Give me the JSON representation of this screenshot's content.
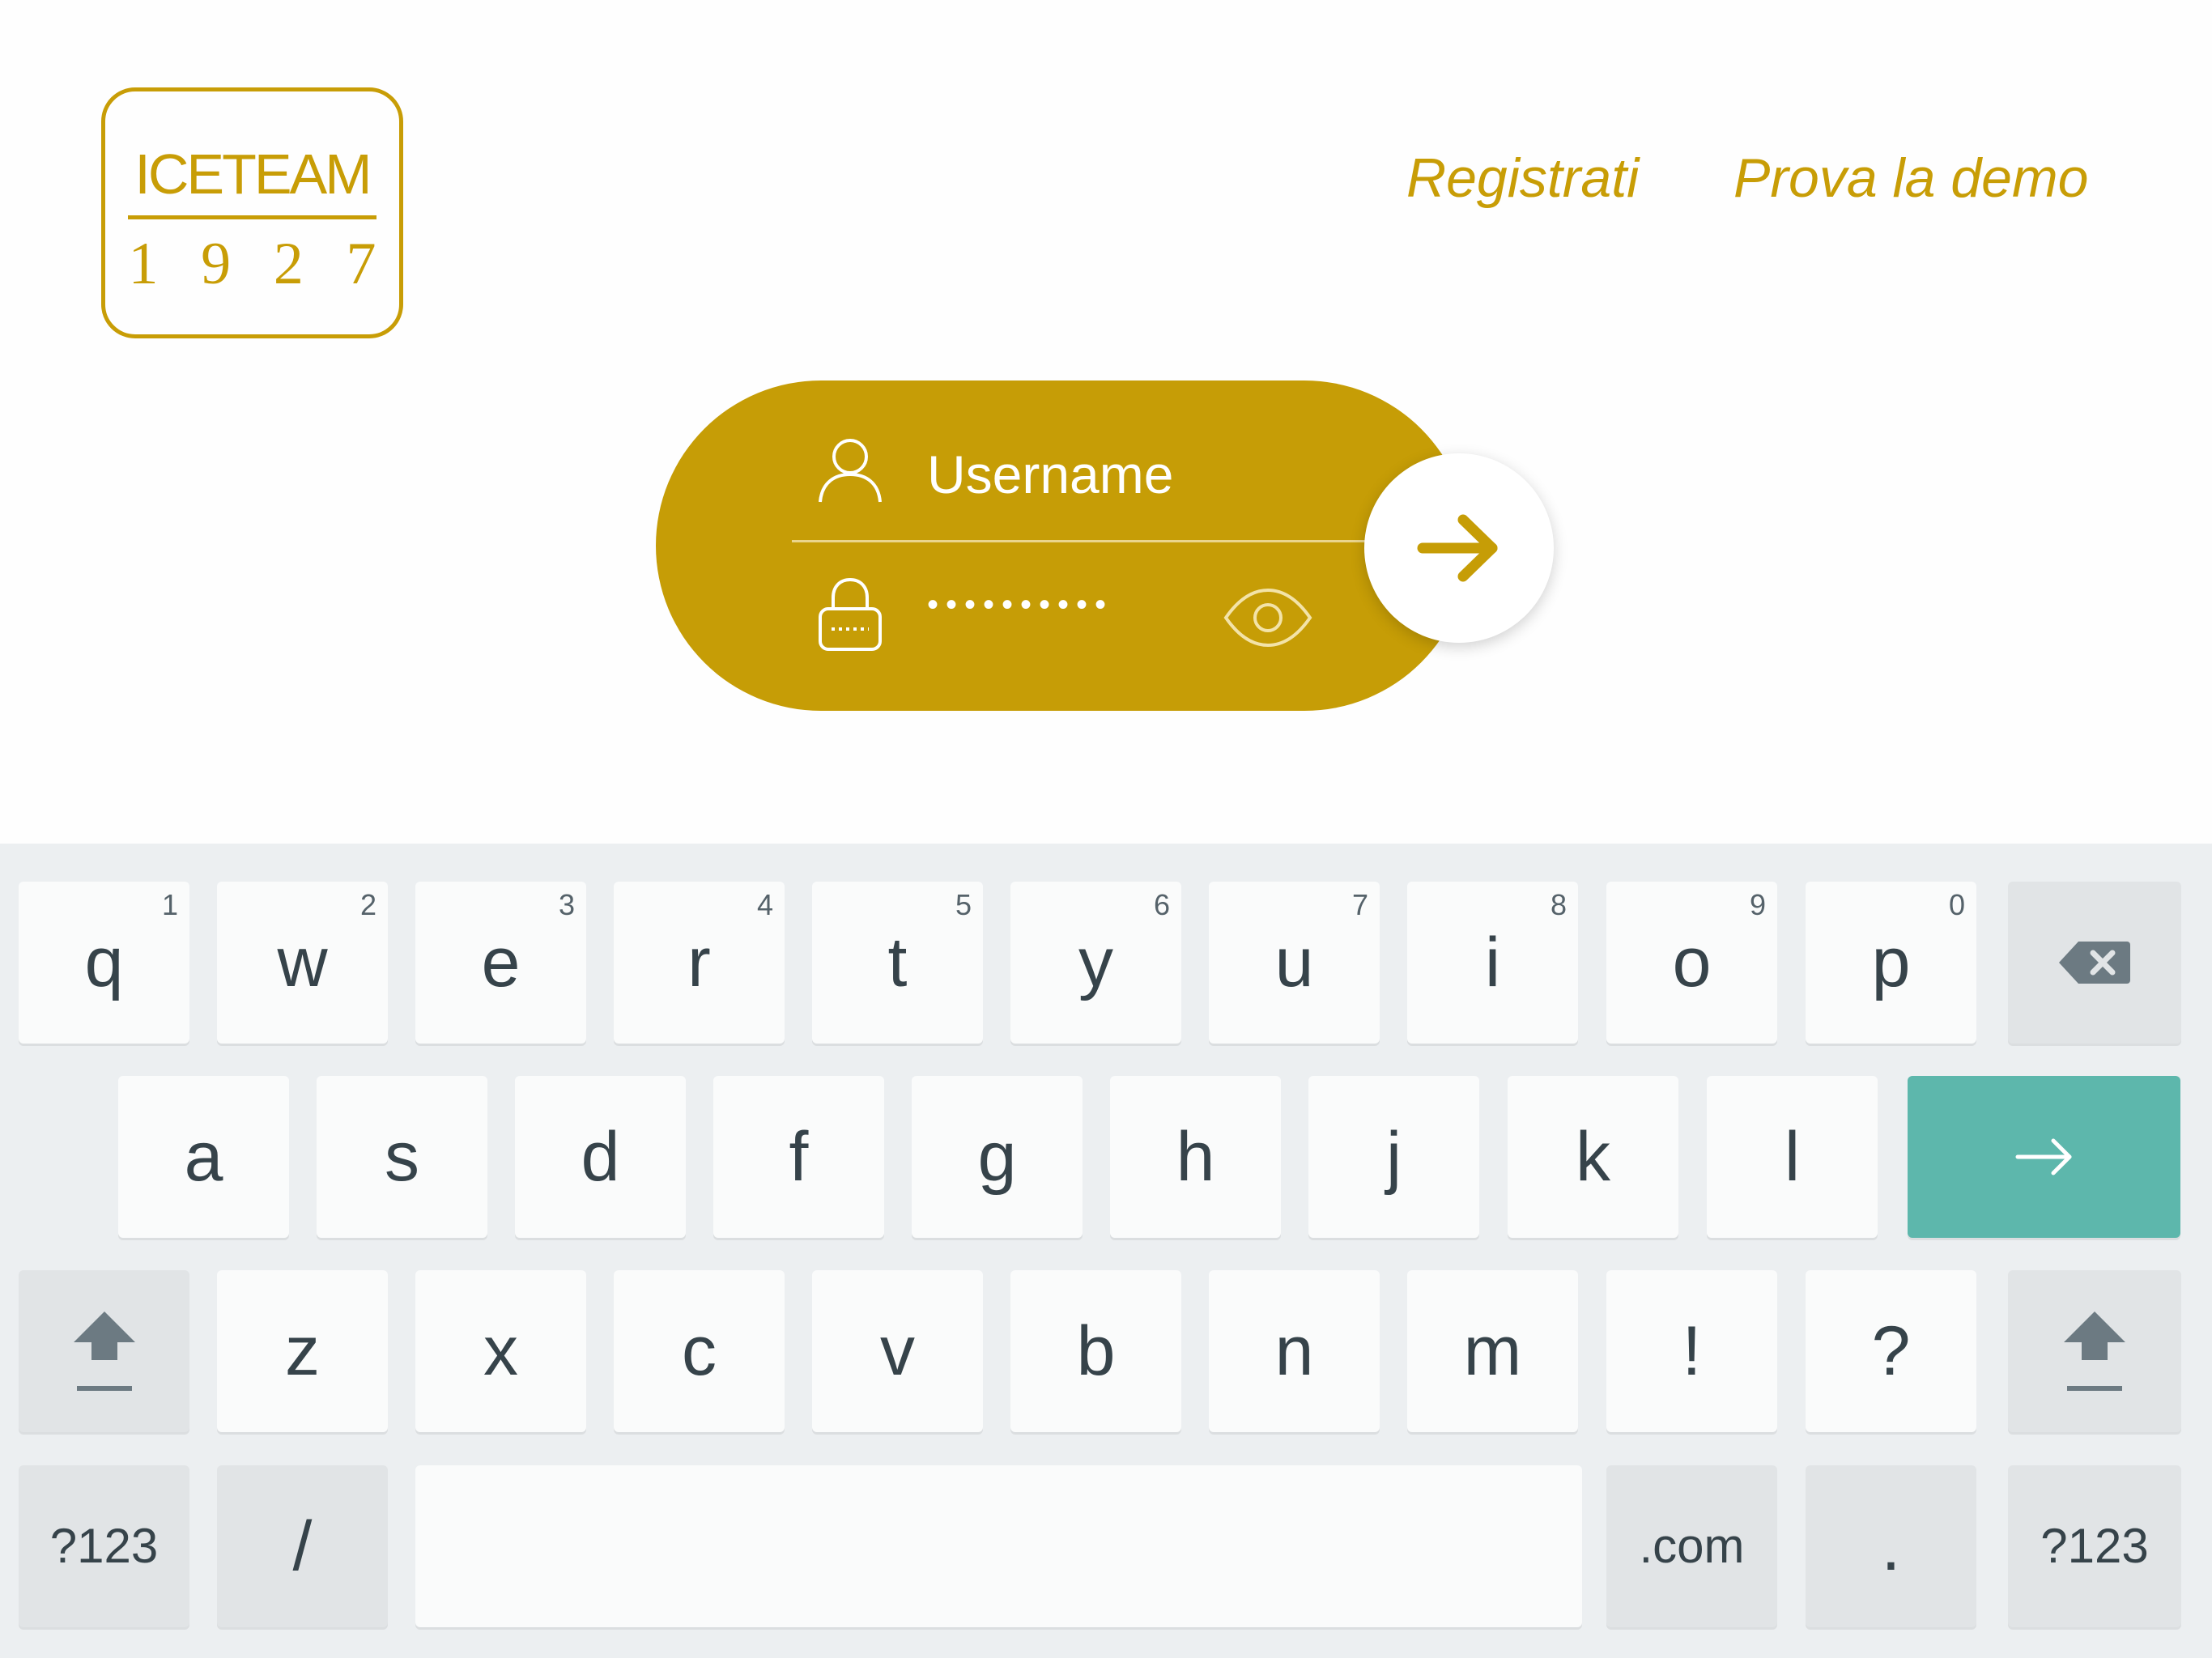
{
  "header": {
    "logo": {
      "word": "ICETEAM",
      "year": [
        "1",
        "9",
        "2",
        "7"
      ]
    },
    "links": {
      "register": "Registrati",
      "demo": "Prova la demo"
    }
  },
  "login": {
    "username_placeholder": "Username",
    "password_dots": "••••••••••",
    "accent_color": "#c69d06"
  },
  "keyboard": {
    "row1": [
      {
        "label": "q",
        "hint": "1"
      },
      {
        "label": "w",
        "hint": "2"
      },
      {
        "label": "e",
        "hint": "3"
      },
      {
        "label": "r",
        "hint": "4"
      },
      {
        "label": "t",
        "hint": "5"
      },
      {
        "label": "y",
        "hint": "6"
      },
      {
        "label": "u",
        "hint": "7"
      },
      {
        "label": "i",
        "hint": "8"
      },
      {
        "label": "o",
        "hint": "9"
      },
      {
        "label": "p",
        "hint": "0"
      }
    ],
    "row2": [
      "a",
      "s",
      "d",
      "f",
      "g",
      "h",
      "j",
      "k",
      "l"
    ],
    "row3": [
      "z",
      "x",
      "c",
      "v",
      "b",
      "n",
      "m",
      "!",
      "?"
    ],
    "row4": {
      "symbols_left": "?123",
      "slash": "/",
      "dotcom": ".com",
      "period": ".",
      "symbols_right": "?123"
    },
    "icons": {
      "backspace": "backspace-icon",
      "enter": "enter-arrow-icon",
      "shift": "shift-icon"
    },
    "enter_color": "#5db7ac"
  }
}
